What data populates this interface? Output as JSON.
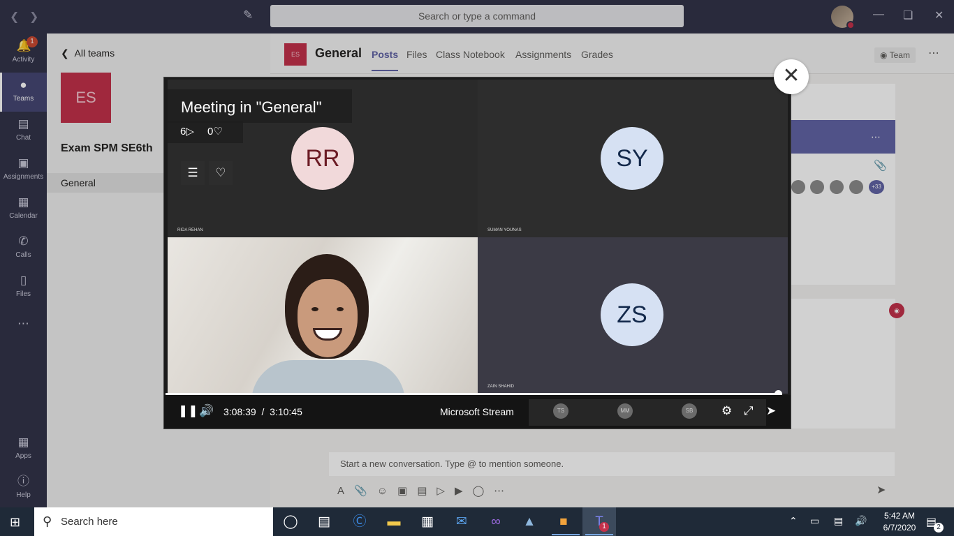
{
  "titlebar": {
    "search_placeholder": "Search or type a command"
  },
  "rail": {
    "items": [
      {
        "label": "Activity",
        "icon": "bell-icon",
        "badge": "1"
      },
      {
        "label": "Teams",
        "icon": "teams-icon"
      },
      {
        "label": "Chat",
        "icon": "chat-icon"
      },
      {
        "label": "Assignments",
        "icon": "backpack-icon"
      },
      {
        "label": "Calendar",
        "icon": "calendar-icon"
      },
      {
        "label": "Calls",
        "icon": "phone-icon"
      },
      {
        "label": "Files",
        "icon": "file-icon"
      },
      {
        "label": "",
        "icon": "more-icon"
      },
      {
        "label": "Apps",
        "icon": "apps-icon"
      },
      {
        "label": "Help",
        "icon": "help-icon"
      }
    ]
  },
  "team_panel": {
    "back_label": "All teams",
    "team_initials": "ES",
    "team_name": "Exam SPM SE6th",
    "channel": "General"
  },
  "channel_header": {
    "tile_initials": "ES",
    "title": "General",
    "tabs": [
      "Posts",
      "Files",
      "Class Notebook",
      "Assignments",
      "Grades"
    ],
    "active_tab": "Posts",
    "team_button": "Team"
  },
  "background": {
    "plus_count": "+33",
    "compose_placeholder": "Start a new conversation. Type @ to mention someone."
  },
  "video": {
    "title": "Meeting in \"General\"",
    "views": "6",
    "likes": "0",
    "participants": [
      {
        "initials": "RR",
        "name": "RIDA REHAN"
      },
      {
        "initials": "SY",
        "name": "SUMAN YOUNAS"
      },
      {
        "initials": "ZS",
        "name": "ZAIN SHAHID"
      }
    ],
    "progress": 0.988,
    "current_time": "3:08:39",
    "separator": "/",
    "total_time": "3:10:45",
    "brand": "Microsoft Stream",
    "thumbnails": [
      "TS",
      "MM",
      "SB"
    ]
  },
  "taskbar": {
    "search_text": "Search here",
    "teams_badge": "1",
    "time": "5:42 AM",
    "date": "6/7/2020",
    "notifications": "2"
  },
  "colors": {
    "rail": "#33344a",
    "accent": "#6264a7",
    "team_tile": "#c4314b",
    "taskbar": "#1f2a38"
  }
}
